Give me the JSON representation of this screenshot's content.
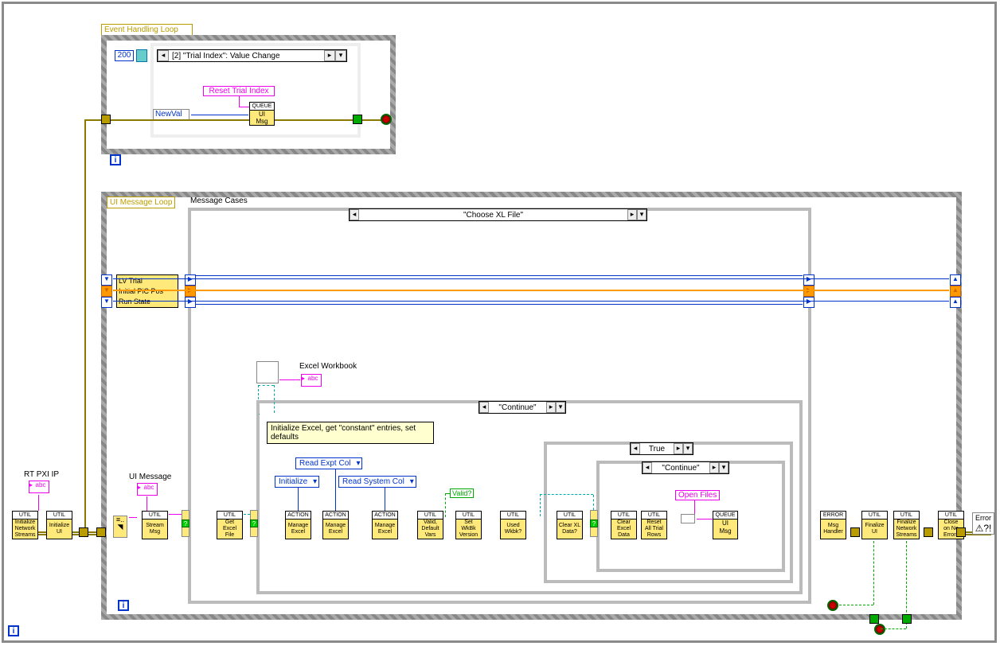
{
  "event_loop": {
    "label": "Event Handling Loop",
    "timeout": "200",
    "event_selector": "[2] \"Trial Index\": Value Change",
    "reset_label": "Reset Trial Index",
    "newval": "NewVal",
    "queue_top": "QUEUE",
    "queue_body": "UI\nMsg"
  },
  "ui_loop": {
    "label": "UI Message Loop",
    "cases_label": "Message Cases",
    "case_selector": "\"Choose XL File\"",
    "cluster": {
      "l1": "LV Trial",
      "l2": "Initial PiC Pos",
      "l3": "Run State"
    },
    "excel_wb_label": "Excel Workbook",
    "comment": "Initialize Excel, get \"constant\" entries, set defaults",
    "ring_read_expt": "Read Expt Col",
    "ring_initialize": "Initialize",
    "ring_read_system": "Read System Col",
    "valid_label": "Valid?",
    "continue_case": "\"Continue\"",
    "true_case": "True",
    "continue_case2": "\"Continue\"",
    "open_files": "Open Files",
    "queue_top": "QUEUE",
    "queue_body": "UI\nMsg"
  },
  "left_nodes": {
    "rt_pxi_label": "RT PXI IP",
    "ui_msg_label": "UI Message"
  },
  "subvis": {
    "util": "UTIL",
    "action": "ACTION",
    "error": "ERROR",
    "init_net": "Initialize\nNetwork\nStreams",
    "init_ui": "Initialize\nUI",
    "stream_msg": "Stream\nMsg",
    "get_excel": "Get\nExcel\nFile",
    "manage_excel": "Manage\nExcel",
    "valid_def": "Valid,\nDefault\nVars",
    "set_wkbk": "Set\nWkBk\nVersion",
    "used_wkbk": "Used\nWkbk?",
    "clear_xl_q": "Clear XL\nData?",
    "clear_xl": "Clear\nExcel\nData",
    "reset_trial": "Reset\nAll Trial\nRows",
    "msg_handler": "Msg\nHandler",
    "finalize_ui": "Finalize\nUI",
    "finalize_net": "Finalize\nNetwork\nStreams",
    "close_err": "Close\non No\nErrors",
    "error_q": "Error\n ?!"
  }
}
